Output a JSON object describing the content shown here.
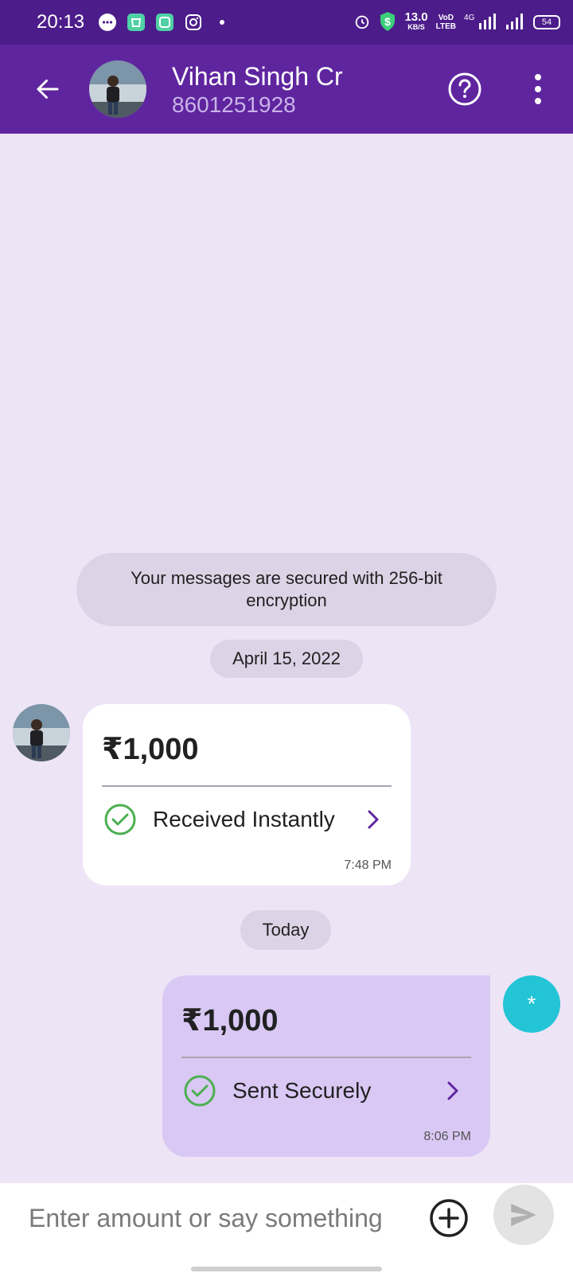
{
  "status_bar": {
    "time": "20:13",
    "net_speed_value": "13.0",
    "net_speed_unit": "KB/S",
    "volte_top": "VoD",
    "volte_bottom": "LTEB",
    "network_type": "4G",
    "battery_level": "54"
  },
  "header": {
    "contact_name": "Vihan Singh Cr",
    "contact_phone": "8601251928",
    "bg_color": "#5f259f"
  },
  "chat": {
    "security_notice": "Your messages are secured with 256-bit encryption",
    "date_separators": [
      "April 15, 2022",
      "Today"
    ],
    "messages": [
      {
        "direction": "received",
        "amount": "₹1,000",
        "status": "Received Instantly",
        "time": "7:48 PM"
      },
      {
        "direction": "sent",
        "amount": "₹1,000",
        "status": "Sent Securely",
        "time": "8:06 PM"
      }
    ],
    "fab_label": "*"
  },
  "composer": {
    "placeholder": "Enter amount or say something"
  },
  "colors": {
    "accent": "#5f259f",
    "status_bar": "#4c1d8a",
    "chat_bg": "#ede4f6",
    "sent_bubble": "#d9c8f4",
    "received_bubble": "#ffffff",
    "success_green": "#4caf50",
    "fab": "#22c4d6"
  }
}
